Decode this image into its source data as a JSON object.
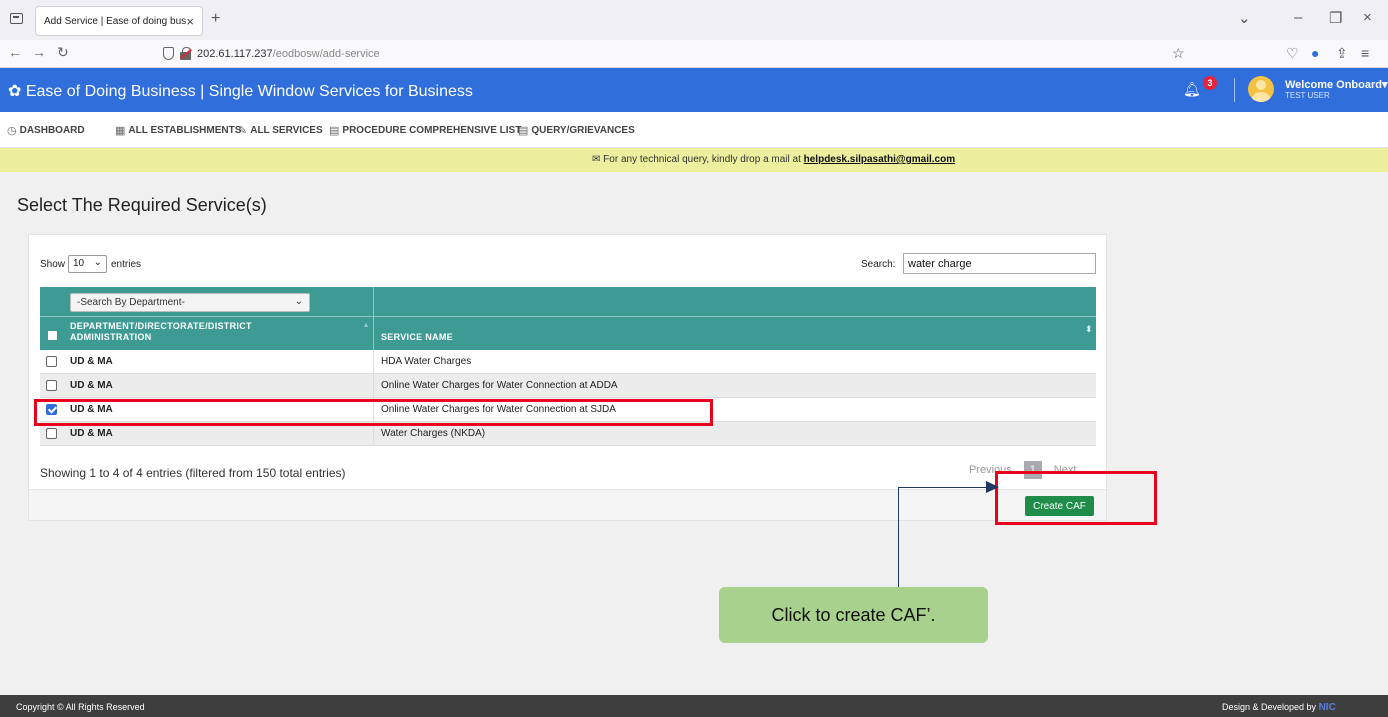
{
  "browser": {
    "tab_title": "Add Service | Ease of doing business",
    "tab_close": "×",
    "new_tab": "+",
    "url_host": "202.61.117.237",
    "url_path": "/eodbosw/add-service"
  },
  "header": {
    "title": "Ease of Doing Business | Single Window Services for Business",
    "notification_count": "3",
    "welcome": "Welcome Onboard",
    "user": "TEST USER"
  },
  "nav": {
    "items": [
      {
        "label": "DASHBOARD",
        "icon": "dashboard-icon"
      },
      {
        "label": "ALL ESTABLISHMENTS",
        "icon": "building-icon"
      },
      {
        "label": "ALL SERVICES",
        "icon": "wrench-icon"
      },
      {
        "label": "PROCEDURE COMPREHENSIVE LIST",
        "icon": "list-icon"
      },
      {
        "label": "QUERY/GRIEVANCES",
        "icon": "list-icon"
      }
    ]
  },
  "notice": {
    "text": "For any technical query, kindly drop a mail at ",
    "email": "helpdesk.silpasathi@gmail.com"
  },
  "page": {
    "title": "Select The Required Service(s)"
  },
  "table_controls": {
    "show_label": "Show",
    "page_size": "10",
    "entries_label": "entries",
    "search_label": "Search:",
    "search_value": "water charge"
  },
  "table": {
    "dept_filter": "-Search By Department-",
    "col_dept_1": "DEPARTMENT/DIRECTORATE/DISTRICT",
    "col_dept_2": "ADMINISTRATION",
    "col_service": "SERVICE NAME",
    "rows": [
      {
        "dept": "UD & MA",
        "service": "HDA Water Charges",
        "checked": false
      },
      {
        "dept": "UD & MA",
        "service": "Online Water Charges for Water Connection at ADDA",
        "checked": false
      },
      {
        "dept": "UD & MA",
        "service": "Online Water Charges for Water Connection at SJDA",
        "checked": true
      },
      {
        "dept": "UD & MA",
        "service": "Water Charges (NKDA)",
        "checked": false
      }
    ],
    "info": "Showing 1 to 4 of 4 entries (filtered from 150 total entries)",
    "pager_prev": "Previous",
    "pager_current": "1",
    "pager_next": "Next"
  },
  "actions": {
    "create_caf": "Create CAF"
  },
  "annotation": {
    "callout": "Click to create CAF’."
  },
  "footer": {
    "copyright": "Copyright © All Rights Reserved",
    "design": "Design & Developed by",
    "design_brand": "NIC"
  },
  "colors": {
    "header_blue": "#2f6edb",
    "table_header_teal": "#3d9b93",
    "button_green": "#1f8c4a",
    "highlight_red": "#e8001c",
    "callout_green": "#a9d18e"
  }
}
